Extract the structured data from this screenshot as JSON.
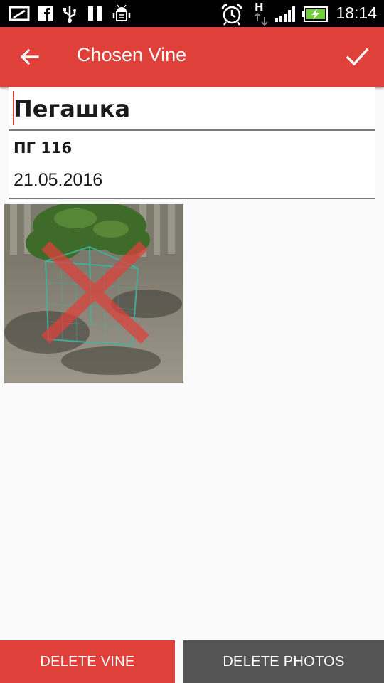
{
  "status_bar": {
    "time": "18:14",
    "network_type": "H",
    "icons": [
      "screen-icon",
      "facebook-icon",
      "usb-icon",
      "pause-icon",
      "android-debug-icon",
      "alarm-icon",
      "network-h-icon",
      "signal-icon",
      "battery-charging-icon"
    ]
  },
  "app_bar": {
    "title": "Chosen Vine",
    "back_icon": "arrow-back-icon",
    "confirm_icon": "check-icon"
  },
  "vine": {
    "name": "Пегашка",
    "code": "ПГ 116",
    "date": "21.05.2016"
  },
  "photo": {
    "overlay_icon": "red-x-icon"
  },
  "buttons": {
    "delete_vine": "DELETE VINE",
    "delete_photos": "DELETE PHOTOS"
  },
  "colors": {
    "accent": "#e0403a",
    "secondary_button": "#555555",
    "status_bar": "#000000"
  }
}
